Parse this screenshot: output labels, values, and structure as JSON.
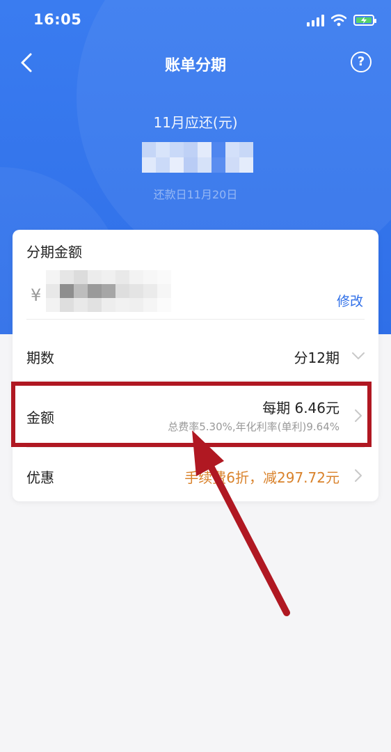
{
  "status_bar": {
    "time": "16:05"
  },
  "nav": {
    "title": "账单分期",
    "help_symbol": "?"
  },
  "summary": {
    "due_label": "11月应还(元)",
    "due_date": "还款日11月20日"
  },
  "card": {
    "amount_title": "分期金额",
    "currency_symbol": "¥",
    "modify_label": "修改",
    "periods": {
      "label": "期数",
      "value": "分12期"
    },
    "amount": {
      "label": "金额",
      "per_period": "每期  6.46元",
      "rate_text": "总费率5.30%,年化利率(单利)9.64%"
    },
    "discount": {
      "label": "优惠",
      "value": "手续费6折，减297.72元"
    }
  },
  "colors": {
    "header_blue": "#2f6fe8",
    "link_blue": "#2f6fe8",
    "discount_orange": "#d9822b",
    "annotation_red": "#b01822",
    "battery_green": "#57d36a"
  }
}
